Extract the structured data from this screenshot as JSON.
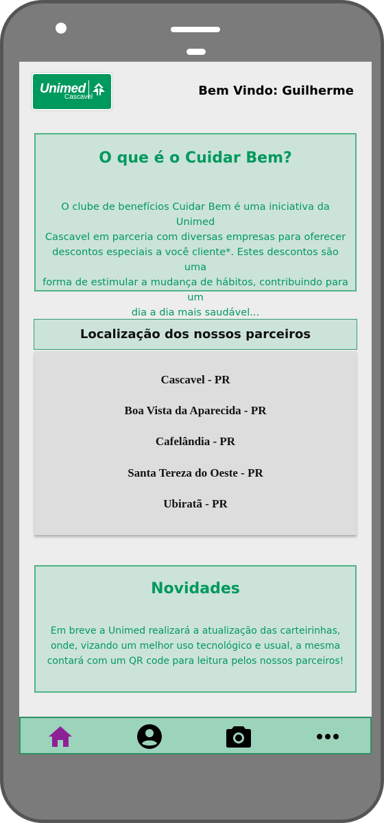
{
  "header": {
    "logo": {
      "brand": "Unimed",
      "sub": "Cascavel"
    },
    "welcome_label": "Bem Vindo:",
    "user_name": "Guilherme"
  },
  "about": {
    "title": "O que é o Cuidar Bem?",
    "lines": [
      "O clube de benefícios Cuidar Bem é uma iniciativa da Unimed",
      "Cascavel em parceria com diversas empresas para oferecer",
      "descontos especiais a você cliente*. Estes descontos são uma",
      "forma de estimular a mudança de hábitos, contribuindo para um",
      "dia a dia mais saudável..."
    ]
  },
  "partners": {
    "title": "Localização dos nossos parceiros",
    "locations": [
      "Cascavel - PR",
      "Boa Vista da Aparecida - PR",
      "Cafelândia - PR",
      "Santa Tereza do Oeste - PR",
      "Ubiratã - PR"
    ]
  },
  "news": {
    "title": "Novidades",
    "lines": [
      "Em breve a Unimed realizará a atualização das carteirinhas,",
      "onde, vizando um melhor uso tecnológico e usual, a mesma",
      "contará com um QR code para leitura pelos nossos parceiros!"
    ]
  },
  "nav": {
    "items": [
      {
        "icon": "home-icon",
        "active": true,
        "color": "#8e2196"
      },
      {
        "icon": "profile-icon",
        "active": false,
        "color": "#000000"
      },
      {
        "icon": "camera-icon",
        "active": false,
        "color": "#000000"
      },
      {
        "icon": "more-icon",
        "active": false,
        "color": "#000000"
      }
    ]
  },
  "colors": {
    "brand_green": "#00995d",
    "card_bg": "#cce3da",
    "nav_bg": "#9cd3bb",
    "active_icon": "#8e2196",
    "phone_body": "#7b7b7b",
    "screen_bg": "#ededed"
  }
}
